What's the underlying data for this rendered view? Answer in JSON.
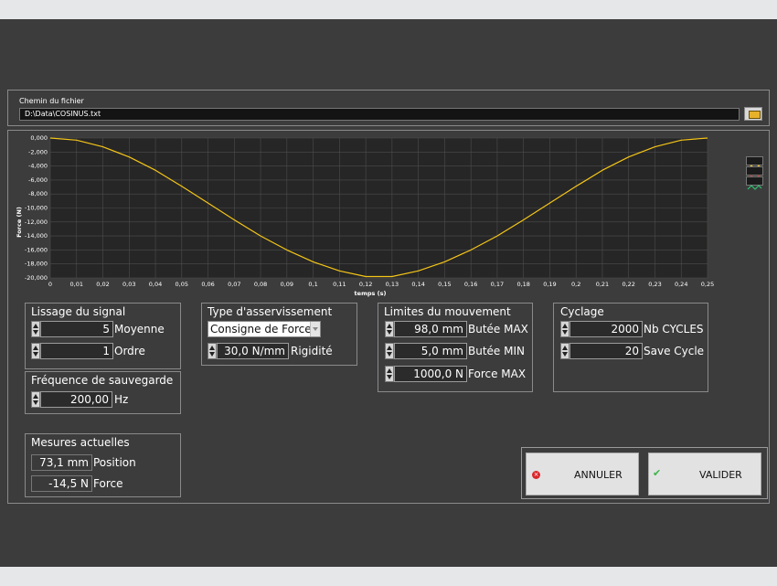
{
  "file": {
    "label": "Chemin du fichier",
    "path": "D:\\Data\\COSINUS.txt"
  },
  "chart_data": {
    "type": "line",
    "xlabel": "temps (s)",
    "ylabel": "Force (N)",
    "xlim": [
      0,
      0.25
    ],
    "ylim": [
      -20000,
      0
    ],
    "x_ticks": [
      "0",
      "0,01",
      "0,02",
      "0,03",
      "0,04",
      "0,05",
      "0,06",
      "0,07",
      "0,08",
      "0,09",
      "0,1",
      "0,11",
      "0,12",
      "0,13",
      "0,14",
      "0,15",
      "0,16",
      "0,17",
      "0,18",
      "0,19",
      "0,2",
      "0,21",
      "0,22",
      "0,23",
      "0,24",
      "0,25"
    ],
    "y_ticks": [
      "0,000",
      "-2,000",
      "-4,000",
      "-6,000",
      "-8,000",
      "-10,000",
      "-12,000",
      "-14,000",
      "-16,000",
      "-18,000",
      "-20,000"
    ],
    "series": [
      {
        "color": "#f5c518",
        "x": [
          0,
          0.01,
          0.02,
          0.03,
          0.04,
          0.05,
          0.06,
          0.07,
          0.08,
          0.09,
          0.1,
          0.11,
          0.12,
          0.13,
          0.14,
          0.15,
          0.16,
          0.17,
          0.18,
          0.19,
          0.2,
          0.21,
          0.22,
          0.23,
          0.24,
          0.25
        ],
        "y": [
          0,
          -300,
          -1250,
          -2700,
          -4600,
          -6900,
          -9300,
          -11700,
          -14000,
          -16000,
          -17700,
          -19000,
          -19800,
          -19800,
          -19000,
          -17700,
          -16000,
          -14000,
          -11700,
          -9300,
          -6900,
          -4600,
          -2700,
          -1250,
          -300,
          0
        ]
      }
    ],
    "grid": true
  },
  "legend_icons": [
    "line-plot-icon-yellow",
    "line-plot-icon-red",
    "line-plot-icon-green"
  ],
  "lissage": {
    "title": "Lissage du signal",
    "moyenne_value": "5",
    "moyenne_label": "Moyenne",
    "ordre_value": "1",
    "ordre_label": "Ordre"
  },
  "frequence": {
    "title": "Fréquence de sauvegarde",
    "value": "200,00",
    "unit": "Hz"
  },
  "asservissement": {
    "title": "Type d'asservissement",
    "mode": "Consigne de Force",
    "rigidite_value": "30,0 N/mm",
    "rigidite_label": "Rigidité"
  },
  "limites": {
    "title": "Limites du mouvement",
    "butee_max_value": "98,0 mm",
    "butee_max_label": "Butée MAX",
    "butee_min_value": "5,0 mm",
    "butee_min_label": "Butée MIN",
    "force_max_value": "1000,0 N",
    "force_max_label": "Force MAX"
  },
  "cyclage": {
    "title": "Cyclage",
    "nb_cycles_value": "2000",
    "nb_cycles_label": "Nb CYCLES",
    "save_cycle_value": "20",
    "save_cycle_label": "Save Cycle"
  },
  "mesures": {
    "title": "Mesures actuelles",
    "position_value": "73,1 mm",
    "position_label": "Position",
    "force_value": "-14,5 N",
    "force_label": "Force"
  },
  "buttons": {
    "annuler": "ANNULER",
    "valider": "VALIDER"
  }
}
